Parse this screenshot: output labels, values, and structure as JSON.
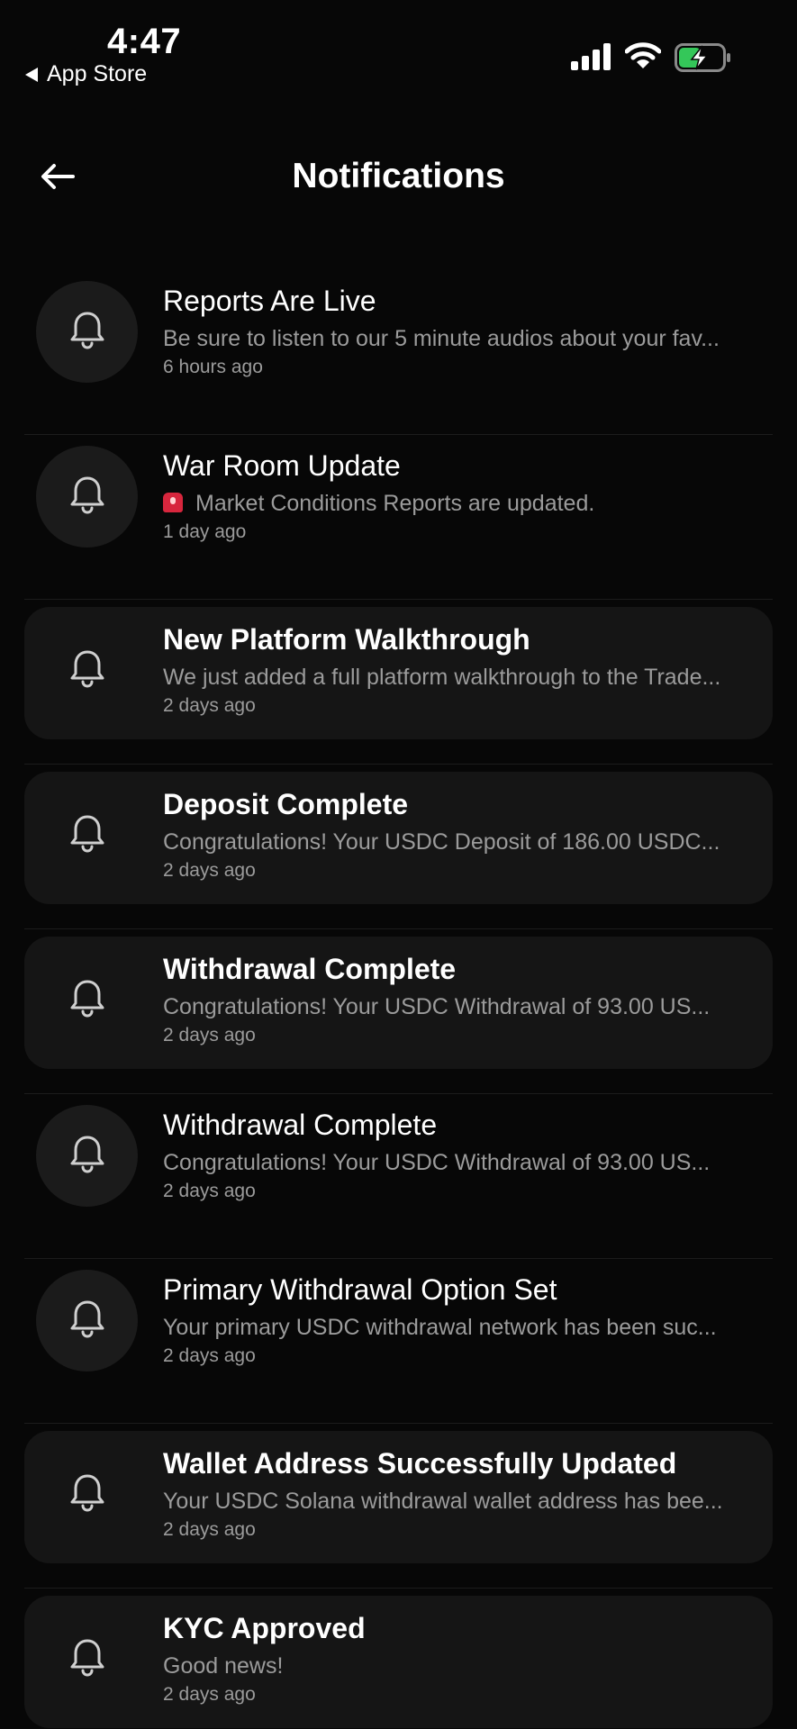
{
  "status_bar": {
    "time": "4:47",
    "back_app_label": "App Store",
    "icons": [
      "signal-icon",
      "wifi-icon",
      "battery-charging-icon"
    ],
    "battery_color": "#34c759"
  },
  "header": {
    "title": "Notifications",
    "back_icon": "arrow-left-icon"
  },
  "colors": {
    "background": "#070707",
    "card": "#151515",
    "muted_text": "#9b9b9b"
  },
  "notifications": [
    {
      "title": "Reports Are Live",
      "body": "Be sure to listen to our 5 minute audios about your fav...",
      "time": "6 hours ago",
      "unread": false
    },
    {
      "title": "War Room Update",
      "body": "Market Conditions Reports are updated.",
      "time": "1 day ago",
      "unread": false,
      "emoji": "siren-icon"
    },
    {
      "title": "New Platform Walkthrough",
      "body": "We just added a full platform walkthrough to the Trade...",
      "time": "2 days ago",
      "unread": true
    },
    {
      "title": "Deposit Complete",
      "body": "Congratulations! Your USDC Deposit of 186.00 USDC...",
      "time": "2 days ago",
      "unread": true
    },
    {
      "title": "Withdrawal Complete",
      "body": "Congratulations! Your USDC Withdrawal of 93.00 US...",
      "time": "2 days ago",
      "unread": true
    },
    {
      "title": "Withdrawal Complete",
      "body": "Congratulations! Your USDC Withdrawal of 93.00 US...",
      "time": "2 days ago",
      "unread": false
    },
    {
      "title": "Primary Withdrawal Option Set",
      "body": "Your primary USDC withdrawal network has been suc...",
      "time": "2 days ago",
      "unread": false
    },
    {
      "title": "Wallet Address Successfully Updated",
      "body": "Your USDC Solana withdrawal wallet address has bee...",
      "time": "2 days ago",
      "unread": true
    },
    {
      "title": "KYC Approved",
      "body": "Good news!",
      "time": "2 days ago",
      "unread": true
    }
  ]
}
